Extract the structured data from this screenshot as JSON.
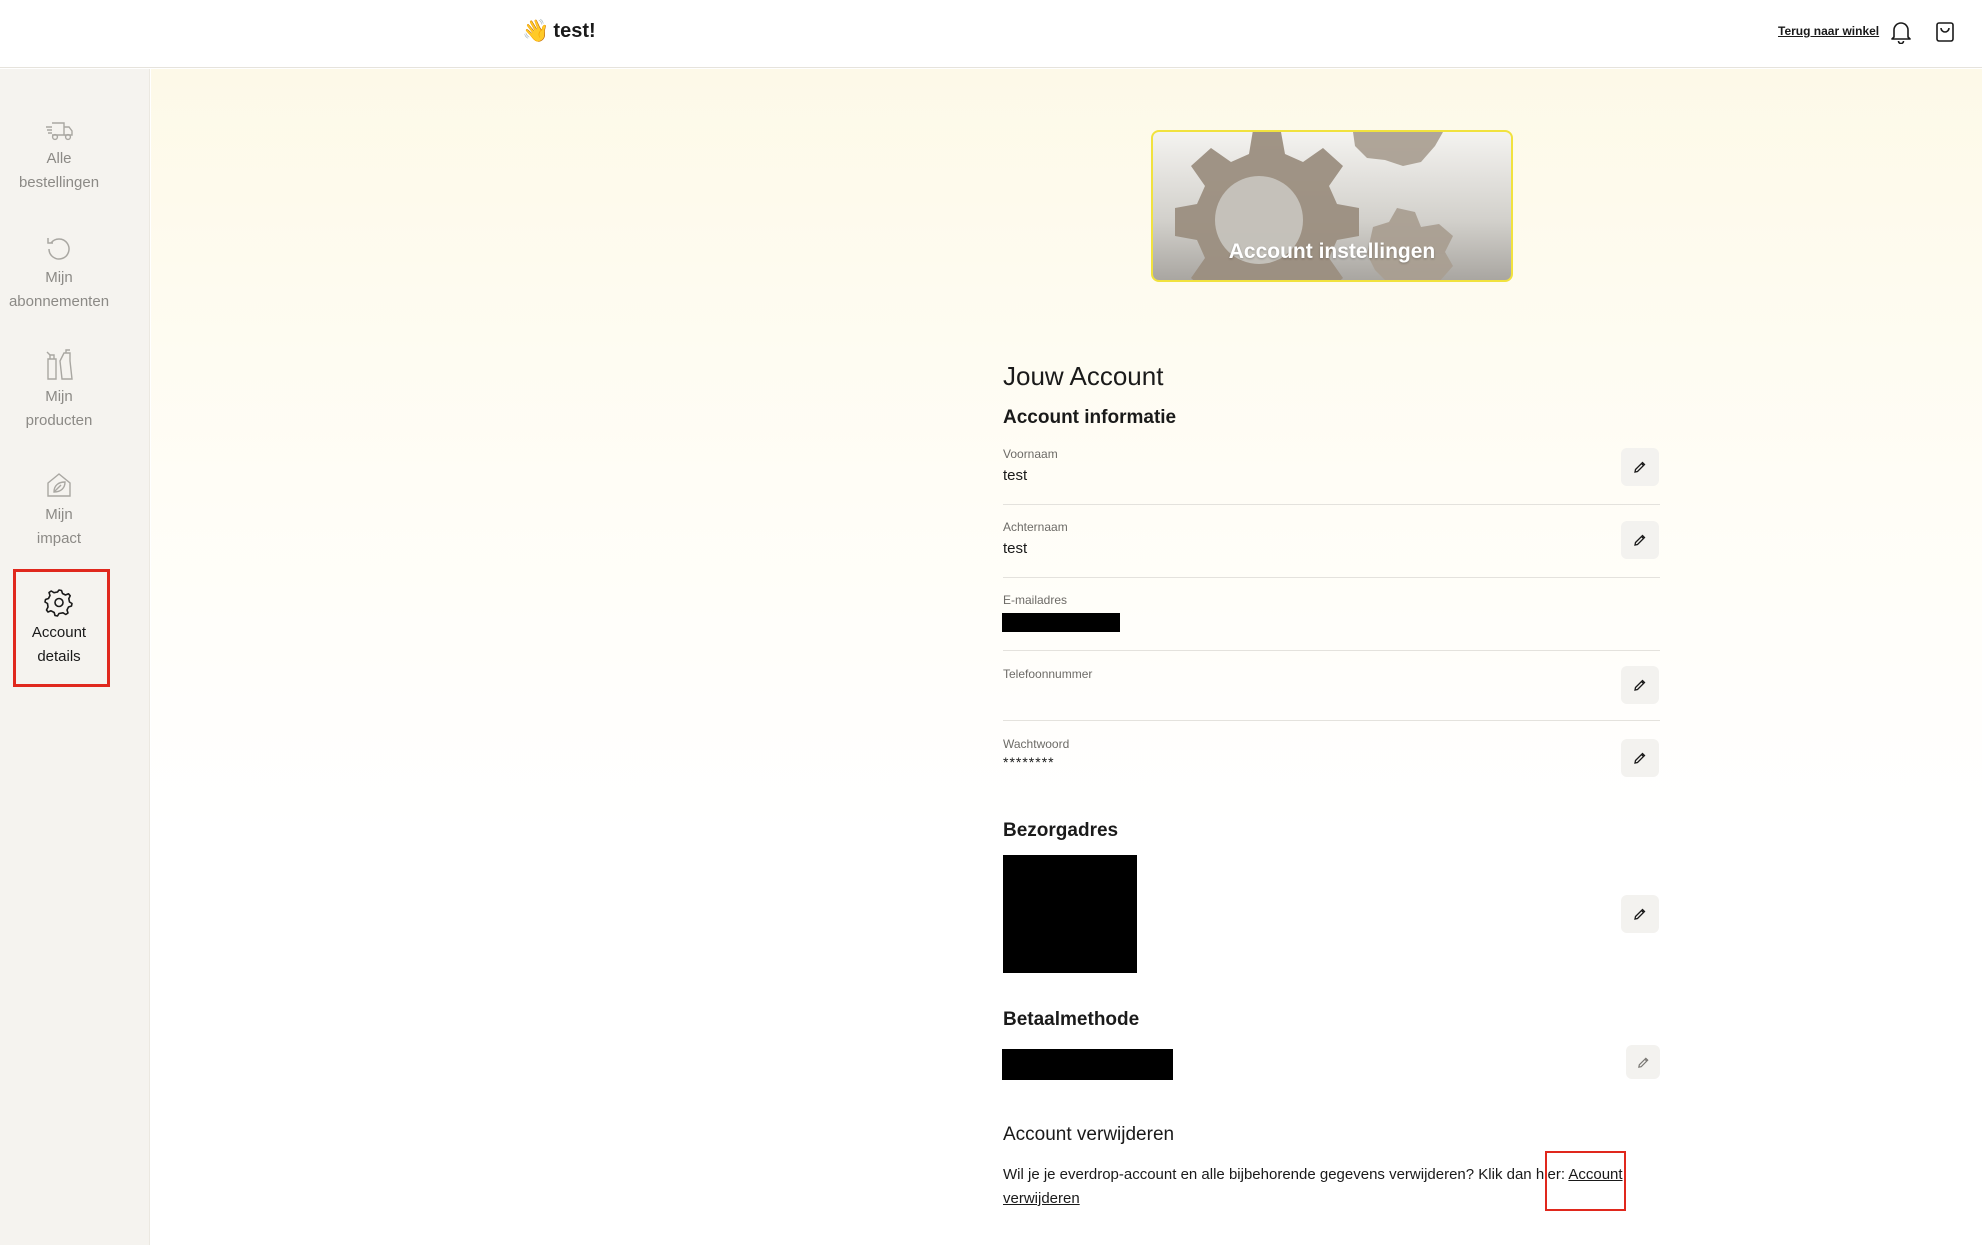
{
  "header": {
    "greeting_emoji": "👋",
    "greeting_text": "test!",
    "back_link": "Terug naar winkel",
    "icons": [
      "bell-icon",
      "shopping-bag-icon"
    ]
  },
  "sidebar": {
    "items": [
      {
        "label_line1": "Alle",
        "label_line2": "bestellingen",
        "icon": "delivery-truck-icon"
      },
      {
        "label_line1": "Mijn",
        "label_line2": "abonnementen",
        "icon": "refresh-icon"
      },
      {
        "label_line1": "Mijn",
        "label_line2": "producten",
        "icon": "spray-bottle-icon"
      },
      {
        "label_line1": "Mijn",
        "label_line2": "impact",
        "icon": "leaf-house-icon"
      },
      {
        "label_line1": "Account",
        "label_line2": "details",
        "icon": "gear-icon",
        "active": true
      }
    ]
  },
  "banner": {
    "title": "Account instellingen"
  },
  "account": {
    "page_title": "Jouw Account",
    "info_title": "Account informatie",
    "fields": [
      {
        "label": "Voornaam",
        "value": "test",
        "editable": true
      },
      {
        "label": "Achternaam",
        "value": "test",
        "editable": true
      },
      {
        "label": "E-mailadres",
        "value": "",
        "editable": false
      },
      {
        "label": "Telefoonnummer",
        "value": "",
        "editable": true
      },
      {
        "label": "Wachtwoord",
        "value": "********",
        "editable": true
      }
    ],
    "address_title": "Bezorgadres",
    "payment_title": "Betaalmethode",
    "delete_title": "Account verwijderen",
    "delete_text": "Wil je je everdrop-account en alle bijbehorende gegevens verwijderen? Klik dan hier:",
    "delete_link": "Account verwijderen"
  },
  "colors": {
    "accent_red": "#e0281d",
    "banner_border": "#f1e23e",
    "sidebar_bg": "#f5f3ef"
  }
}
